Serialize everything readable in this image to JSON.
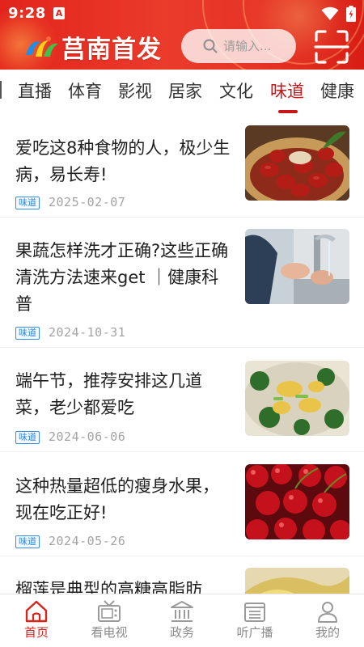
{
  "status_bar": {
    "time": "9:28",
    "notification_badge": "A"
  },
  "header": {
    "app_title": "莒南首发",
    "search_placeholder": "请输入...",
    "brand_color": "#e2241c"
  },
  "tabs": [
    {
      "label": "直播"
    },
    {
      "label": "体育"
    },
    {
      "label": "影视"
    },
    {
      "label": "居家"
    },
    {
      "label": "文化"
    },
    {
      "label": "味道",
      "active": true
    },
    {
      "label": "健康"
    }
  ],
  "feed": [
    {
      "title": "爱吃这8种食物的人，极少生病，易长寿!",
      "tag": "味道",
      "date": "2025-02-07",
      "image": "red-dates-photo"
    },
    {
      "title": "果蔬怎样洗才正确?这些正确清洗方法速来get ｜健康科普",
      "tag": "味道",
      "date": "2024-10-31",
      "image": "washing-vegetables-photo"
    },
    {
      "title": "端午节，推荐安排这几道菜，老少都爱吃",
      "tag": "味道",
      "date": "2024-06-06",
      "image": "stir-fry-dish-photo"
    },
    {
      "title": "这种热量超低的瘦身水果，现在吃正好!",
      "tag": "味道",
      "date": "2024-05-26",
      "image": "cherries-photo"
    },
    {
      "title": "榴莲是典型的高糖高脂肪",
      "tag": "",
      "date": "",
      "image": "durian-photo"
    }
  ],
  "bottom_nav": [
    {
      "label": "首页",
      "icon": "home-icon",
      "active": true
    },
    {
      "label": "看电视",
      "icon": "tv-icon"
    },
    {
      "label": "政务",
      "icon": "government-icon"
    },
    {
      "label": "听广播",
      "icon": "radio-icon"
    },
    {
      "label": "我的",
      "icon": "user-icon"
    }
  ],
  "colors": {
    "active_tab": "#c7171b",
    "tag_blue": "#2f86dc",
    "date_gray": "#a3a3a3",
    "nav_active": "#d7251c"
  }
}
